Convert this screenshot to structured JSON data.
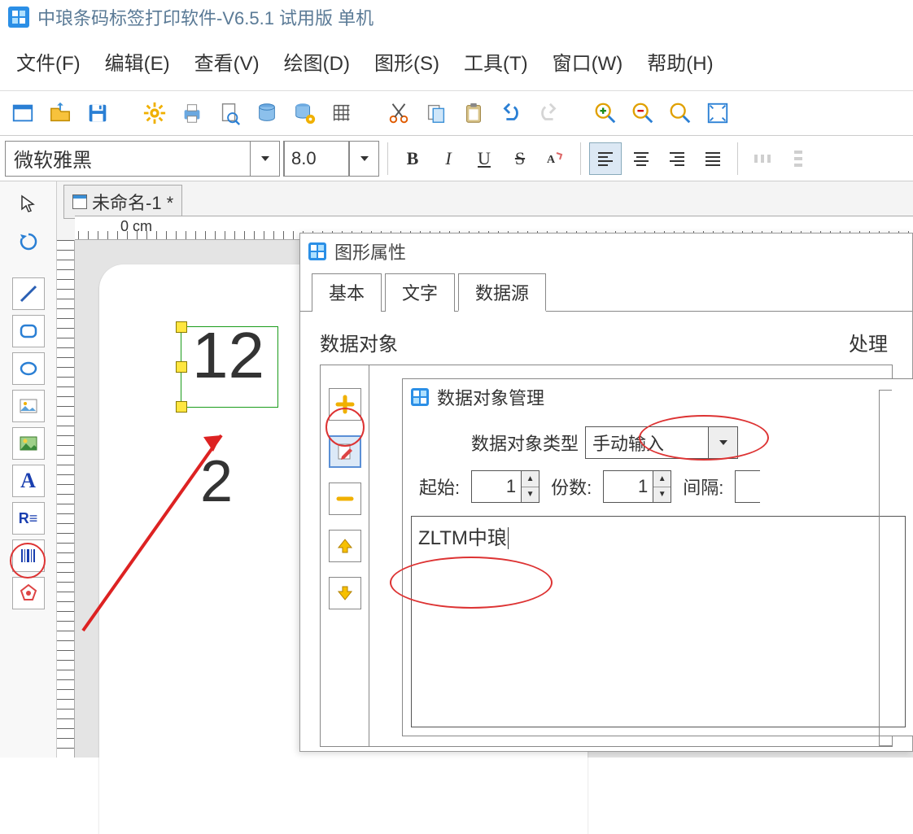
{
  "app": {
    "title": "中琅条码标签打印软件-V6.5.1 试用版 单机"
  },
  "menus": {
    "file": "文件(F)",
    "edit": "编辑(E)",
    "view": "查看(V)",
    "draw": "绘图(D)",
    "shape": "图形(S)",
    "tool": "工具(T)",
    "window": "窗口(W)",
    "help": "帮助(H)"
  },
  "font": {
    "name": "微软雅黑",
    "size": "8.0"
  },
  "format": {
    "bold": "B",
    "italic": "I",
    "underline": "U",
    "strike": "S"
  },
  "doc": {
    "tab": "未命名-1 *",
    "ruler_zero": "0 cm"
  },
  "canvas": {
    "text1": "12",
    "text2": "2"
  },
  "dialog": {
    "title": "图形属性",
    "tabs": {
      "basic": "基本",
      "text": "文字",
      "data": "数据源"
    },
    "section": "数据对象",
    "processing": "处理"
  },
  "inner": {
    "title": "数据对象管理",
    "type_label": "数据对象类型",
    "type_value": "手动输入",
    "start_label": "起始:",
    "start_value": "1",
    "count_label": "份数:",
    "count_value": "1",
    "interval_label": "间隔:",
    "text_value": "ZLTM中琅"
  }
}
